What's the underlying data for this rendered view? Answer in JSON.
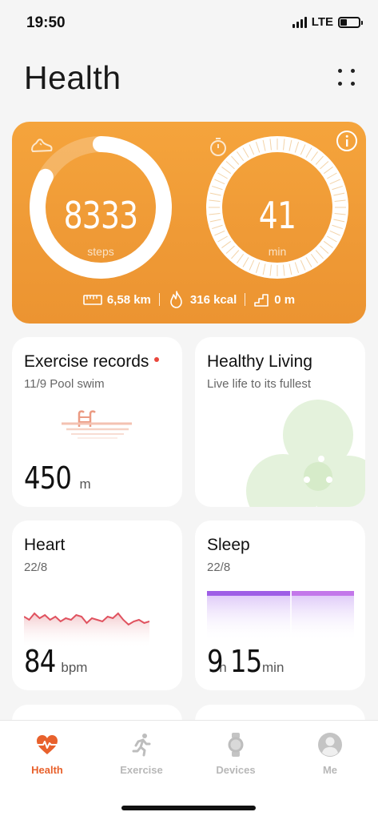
{
  "status_bar": {
    "time": "19:50",
    "network": "LTE",
    "battery_level": 0.35
  },
  "header": {
    "title": "Health",
    "more_icon": "dots-grid-icon"
  },
  "summary": {
    "steps": {
      "value": "8333",
      "unit": "steps",
      "icon": "shoe-icon",
      "progress": 0.83
    },
    "duration": {
      "value": "41",
      "unit": "min",
      "icon": "stopwatch-icon"
    },
    "stats": {
      "distance": "6,58 km",
      "calories": "316 kcal",
      "climb": "0 m"
    },
    "accent_color": "#f09c34"
  },
  "tiles": {
    "exercise": {
      "title": "Exercise records",
      "subtitle": "11/9 Pool swim",
      "value": "450",
      "unit": "m"
    },
    "healthy": {
      "title": "Healthy Living",
      "subtitle": "Live life to its fullest"
    },
    "heart": {
      "title": "Heart",
      "subtitle": "22/8",
      "value": "84",
      "unit": "bpm",
      "series": [
        72,
        70,
        74,
        71,
        73,
        70,
        72,
        69,
        71,
        70,
        73,
        72,
        68,
        71,
        70,
        69,
        72,
        71,
        74,
        70,
        67,
        69,
        70,
        68,
        69
      ]
    },
    "sleep": {
      "title": "Sleep",
      "subtitle": "22/8",
      "hours": "9",
      "hours_unit": "h",
      "minutes": "15",
      "minutes_unit": "min"
    }
  },
  "nav": [
    {
      "label": "Health",
      "icon": "heart-pulse-icon",
      "active": true
    },
    {
      "label": "Exercise",
      "icon": "running-icon",
      "active": false
    },
    {
      "label": "Devices",
      "icon": "watch-icon",
      "active": false
    },
    {
      "label": "Me",
      "icon": "avatar-icon",
      "active": false
    }
  ]
}
